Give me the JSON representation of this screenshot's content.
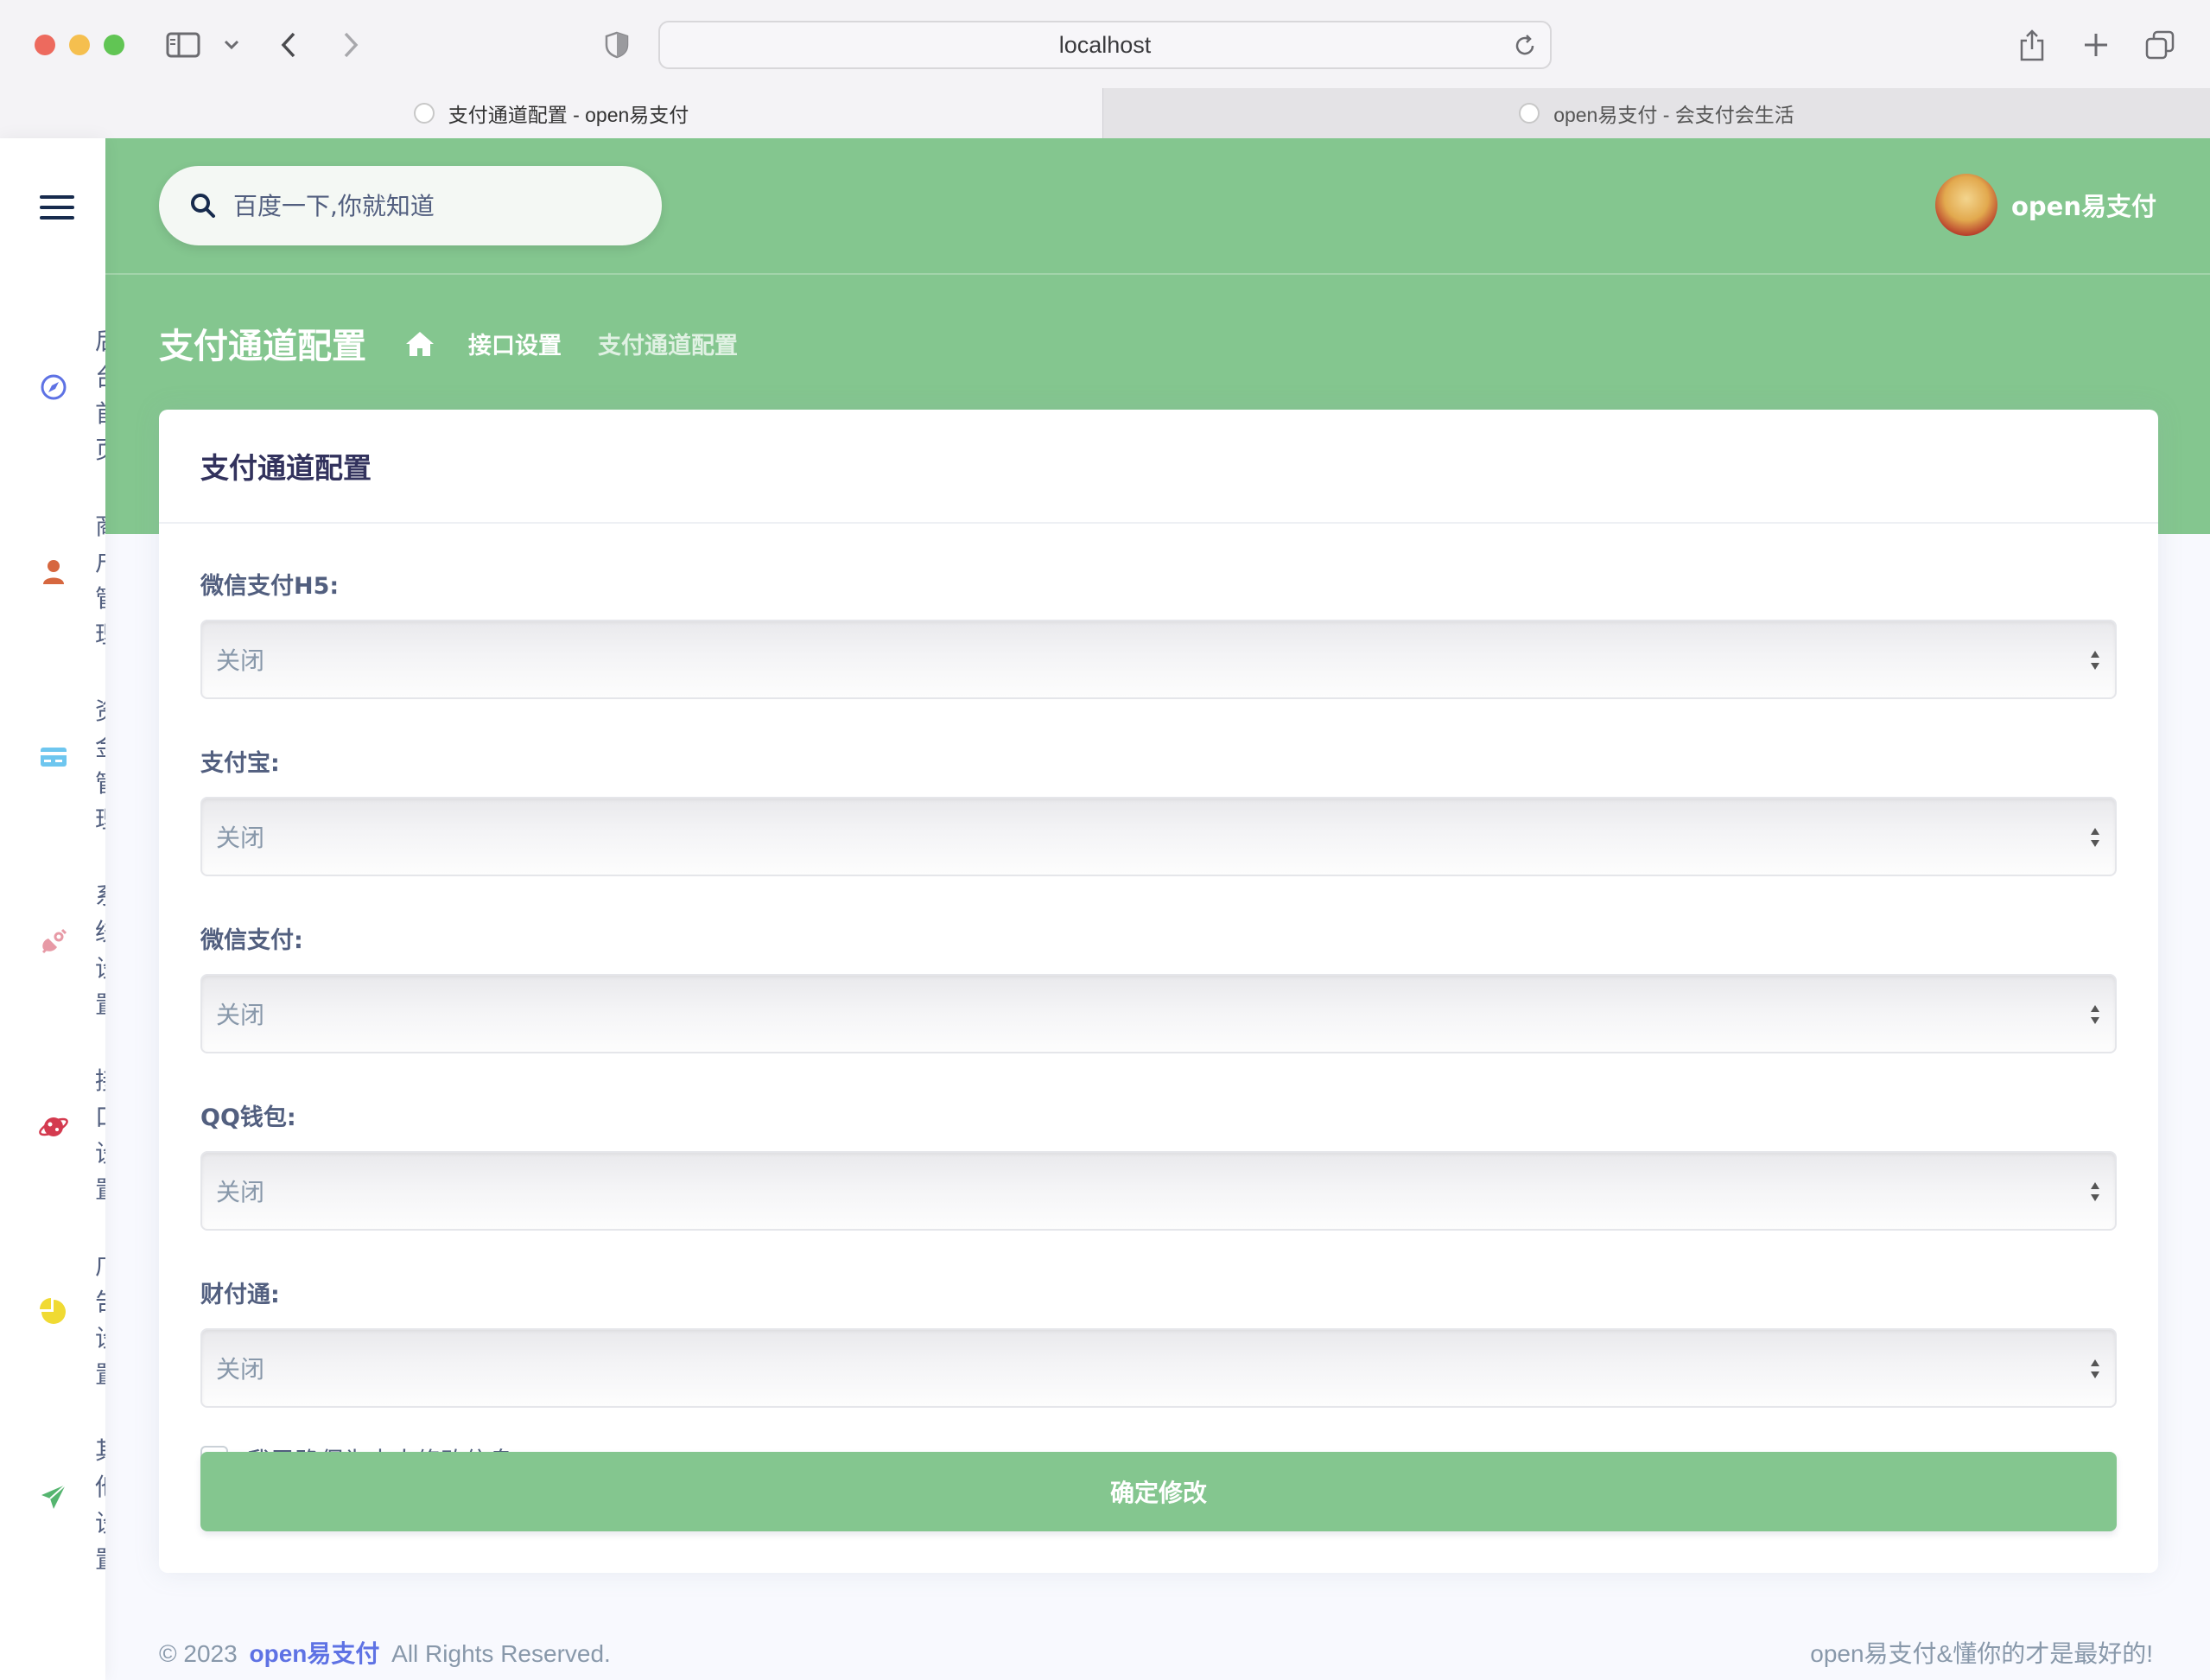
{
  "browser": {
    "url": "localhost",
    "tabs": [
      {
        "title": "支付通道配置 - open易支付",
        "active": true
      },
      {
        "title": "open易支付 - 会支付会生活",
        "active": false
      }
    ]
  },
  "sidebar": {
    "items": [
      {
        "label": "后台首页",
        "icon": "compass-icon",
        "color": "#5e72e4"
      },
      {
        "label": "商户管理",
        "icon": "user-icon",
        "color": "#d6673f"
      },
      {
        "label": "资金管理",
        "icon": "credit-card-icon",
        "color": "#6ec6ef"
      },
      {
        "label": "系统设置",
        "icon": "satellite-icon",
        "color": "#e79aa6"
      },
      {
        "label": "接口设置",
        "icon": "planet-icon",
        "color": "#d43a4f"
      },
      {
        "label": "广告设置",
        "icon": "pie-chart-icon",
        "color": "#f0da33"
      },
      {
        "label": "其他设置",
        "icon": "send-icon",
        "color": "#55b56f"
      }
    ]
  },
  "header": {
    "search_placeholder": "百度一下,你就知道",
    "user_name": "open易支付",
    "page_title": "支付通道配置",
    "breadcrumb": [
      "接口设置",
      "支付通道配置"
    ],
    "accent_color": "#84c68f"
  },
  "card": {
    "title": "支付通道配置",
    "fields": [
      {
        "label": "微信支付H5:",
        "value": "关闭"
      },
      {
        "label": "支付宝:",
        "value": "关闭"
      },
      {
        "label": "微信支付:",
        "value": "关闭"
      },
      {
        "label": "QQ钱包:",
        "value": "关闭"
      },
      {
        "label": "财付通:",
        "value": "关闭"
      }
    ],
    "confirm_label": "我已确保为本人修改信息",
    "submit_label": "确定修改"
  },
  "footer": {
    "copyright": "© 2023",
    "brand": "open易支付",
    "rights": "All Rights Reserved.",
    "right_text": "open易支付&懂你的才是最好的!"
  }
}
